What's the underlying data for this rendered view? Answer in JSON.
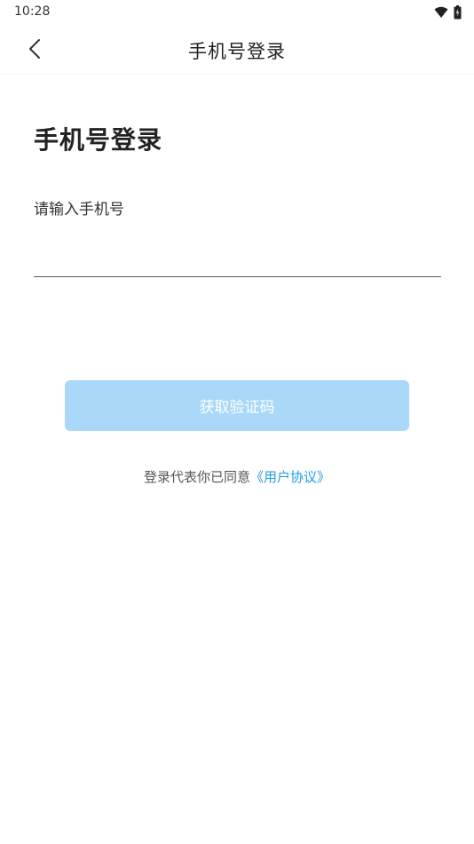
{
  "status_bar": {
    "time": "10:28",
    "icons": [
      "wifi-icon",
      "battery-icon"
    ]
  },
  "app_bar": {
    "back_icon": "chevron-left-icon",
    "title": "手机号登录"
  },
  "main": {
    "heading": "手机号登录",
    "phone_label": "请输入手机号",
    "phone_value": "",
    "get_code_label": "获取验证码",
    "agreement_text": "登录代表你已同意",
    "agreement_link": "《用户协议》"
  },
  "colors": {
    "accent": "#1e9be8",
    "button_disabled": "#a9d8f8",
    "text": "#222222",
    "background": "#ffffff"
  }
}
